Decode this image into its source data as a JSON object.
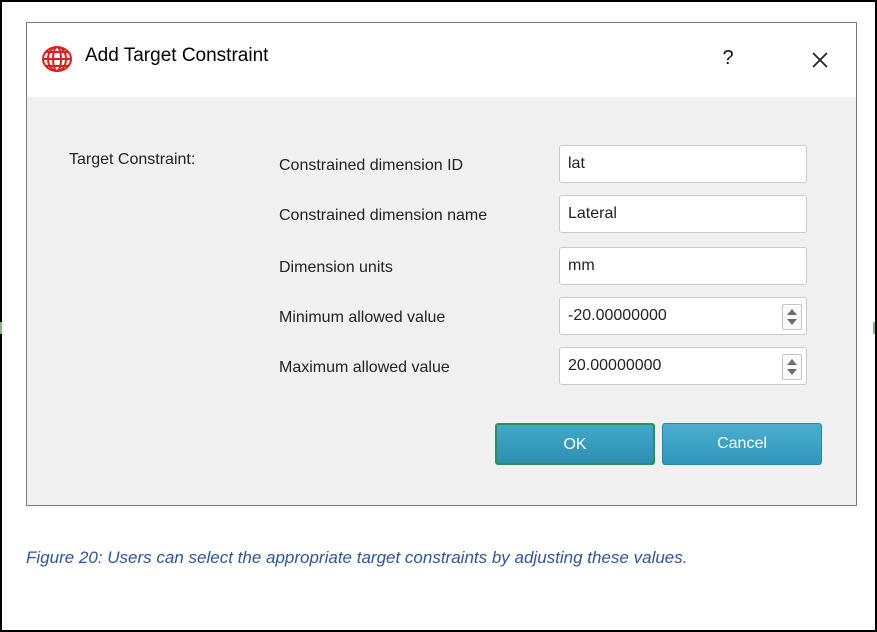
{
  "dialog": {
    "title": "Add Target Constraint",
    "help_label": "?",
    "section_label": "Target Constraint:",
    "fields": [
      {
        "label": "Constrained dimension ID",
        "value": "lat"
      },
      {
        "label": "Constrained dimension name",
        "value": "Lateral"
      },
      {
        "label": "Dimension units",
        "value": "mm"
      }
    ],
    "spinners": [
      {
        "label": "Minimum allowed value",
        "value": "-20.00000000"
      },
      {
        "label": "Maximum allowed value",
        "value": "20.00000000"
      }
    ],
    "buttons": {
      "ok": "OK",
      "cancel": "Cancel"
    }
  },
  "caption": "Figure 20: Users can select the appropriate target constraints by adjusting these values.",
  "colors": {
    "caption": "#2f5597",
    "button": "#3196ba",
    "dialog_bg": "#f0f0f0",
    "titlebar_bg": "#ffffff"
  },
  "icons": {
    "app": "app-logo-icon",
    "help": "help-icon",
    "close": "close-icon",
    "spin_up": "spin-up-icon",
    "spin_down": "spin-down-icon"
  }
}
